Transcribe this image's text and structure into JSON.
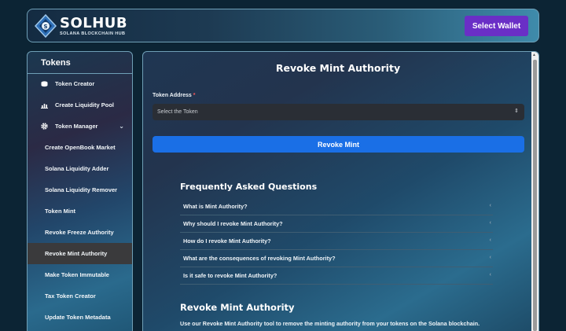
{
  "header": {
    "brand": "SOLHUB",
    "tagline": "SOLANA BLOCKCHAIN HUB",
    "wallet_button": "Select Wallet"
  },
  "sidebar": {
    "title": "Tokens",
    "items": [
      {
        "label": "Token Creator",
        "icon": "coins-icon"
      },
      {
        "label": "Create Liquidity Pool",
        "icon": "chart-icon"
      },
      {
        "label": "Token Manager",
        "icon": "gear-icon"
      },
      {
        "label": "Create OpenBook Market"
      },
      {
        "label": "Solana Liquidity Adder"
      },
      {
        "label": "Solana Liquidity Remover"
      },
      {
        "label": "Token Mint"
      },
      {
        "label": "Revoke Freeze Authority"
      },
      {
        "label": "Revoke Mint Authority",
        "active": true
      },
      {
        "label": "Make Token Immutable"
      },
      {
        "label": "Tax Token Creator"
      },
      {
        "label": "Update Token Metadata"
      }
    ]
  },
  "main": {
    "title": "Revoke Mint Authority",
    "field_label": "Token Address",
    "required_mark": "*",
    "select_value": "Select the Token",
    "button": "Revoke Mint",
    "faq_title": "Frequently Asked Questions",
    "faq": [
      "What is Mint Authority?",
      "Why should I revoke Mint Authority?",
      "How do I revoke Mint Authority?",
      "What are the consequences of revoking Mint Authority?",
      "Is it safe to revoke Mint Authority?"
    ],
    "section_title": "Revoke Mint Authority",
    "section_desc": "Use our Revoke Mint Authority tool to remove the minting authority from your tokens on the Solana blockchain."
  },
  "colors": {
    "accent_button": "#1a6fe6",
    "wallet_button": "#6a2fc6",
    "required": "#ff5a5a"
  }
}
